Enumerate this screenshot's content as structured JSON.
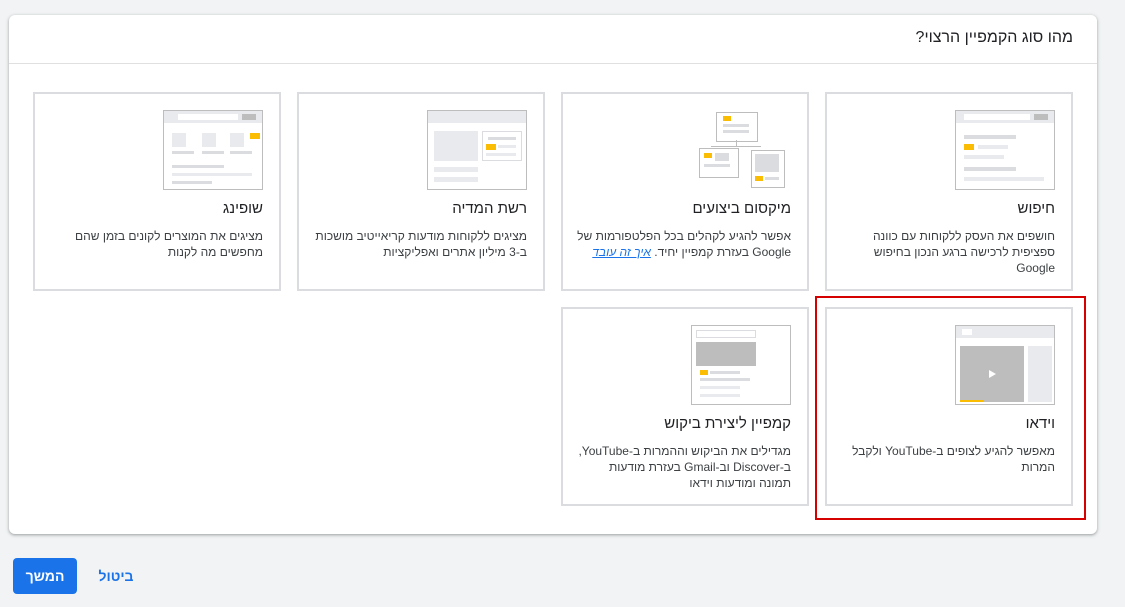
{
  "panel": {
    "title": "מהו סוג הקמפיין הרצוי?"
  },
  "cards": {
    "search": {
      "title": "חיפוש",
      "desc": "חושפים את העסק ללקוחות עם כוונה ספציפית לרכישה ברגע הנכון בחיפוש Google"
    },
    "pmax": {
      "title": "מיקסום ביצועים",
      "desc": "אפשר להגיע לקהלים בכל הפלטפורמות של Google בעזרת קמפיין יחיד.",
      "link": "איך זה עובד"
    },
    "display": {
      "title": "רשת המדיה",
      "desc": "מציגים ללקוחות מודעות קריאייטיב מושכות ב-3 מיליון אתרים ואפליקציות"
    },
    "shopping": {
      "title": "שופינג",
      "desc": "מציגים את המוצרים לקונים בזמן שהם מחפשים מה לקנות"
    },
    "video": {
      "title": "וידאו",
      "desc": "מאפשר להגיע לצופים ב-YouTube ולקבל המרות"
    },
    "demandgen": {
      "title": "קמפיין ליצירת ביקוש",
      "desc": "מגדילים את הביקוש וההמרות ב-YouTube, ב-Discover וב-Gmail בעזרת מודעות תמונה ומודעות וידאו"
    }
  },
  "footer": {
    "continue_label": "המשך",
    "cancel_label": "ביטול"
  },
  "colors": {
    "accent": "#1a73e8",
    "highlight": "#fbbc04",
    "selection": "#d50000"
  },
  "icons": {
    "video_play": "play-icon",
    "search": "search-icon"
  }
}
